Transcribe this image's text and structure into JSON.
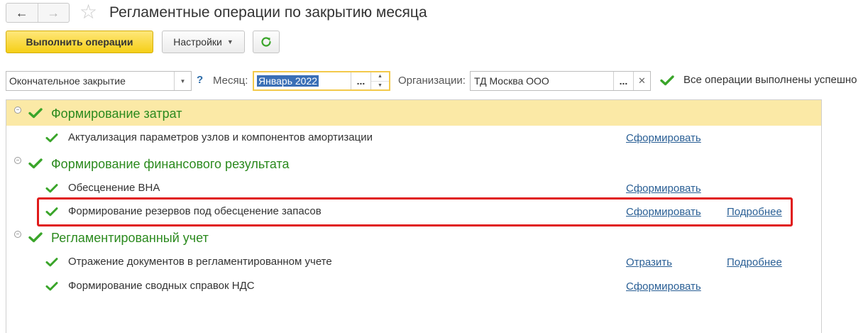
{
  "header": {
    "title": "Регламентные операции по закрытию месяца",
    "back_label": "←",
    "forward_label": "→"
  },
  "toolbar": {
    "run_label": "Выполнить операции",
    "settings_label": "Настройки"
  },
  "filters": {
    "mode_value": "Окончательное закрытие",
    "help_label": "?",
    "month_label": "Месяц:",
    "month_value": "Январь 2022",
    "dots_label": "...",
    "org_label": "Организации:",
    "org_value": "ТД Москва ООО",
    "status_text": "Все операции выполнены успешно"
  },
  "groups": [
    {
      "title": "Формирование затрат",
      "items": [
        {
          "label": "Актуализация параметров узлов и компонентов амортизации",
          "action": "Сформировать",
          "details": ""
        }
      ]
    },
    {
      "title": "Формирование финансового результата",
      "items": [
        {
          "label": "Обесценение ВНА",
          "action": "Сформировать",
          "details": ""
        },
        {
          "label": "Формирование резервов под обесценение запасов",
          "action": "Сформировать",
          "details": "Подробнее"
        }
      ]
    },
    {
      "title": "Регламентированный учет",
      "items": [
        {
          "label": "Отражение документов в регламентированном учете",
          "action": "Отразить",
          "details": "Подробнее"
        },
        {
          "label": "Формирование сводных справок НДС",
          "action": "Сформировать",
          "details": ""
        }
      ]
    }
  ],
  "colors": {
    "accent_green": "#2b8a1e",
    "check_green": "#3aa52a",
    "link_blue": "#2a5f95",
    "primary_yellow": "#f5cf17",
    "highlight_row": "#fbe9a6",
    "annotation_red": "#e01a1a"
  },
  "icons": {
    "back": "arrow-left-icon",
    "forward": "arrow-right-icon",
    "favorite": "star-icon",
    "refresh": "refresh-icon",
    "check": "checkmark-icon",
    "collapse": "collapse-icon"
  }
}
